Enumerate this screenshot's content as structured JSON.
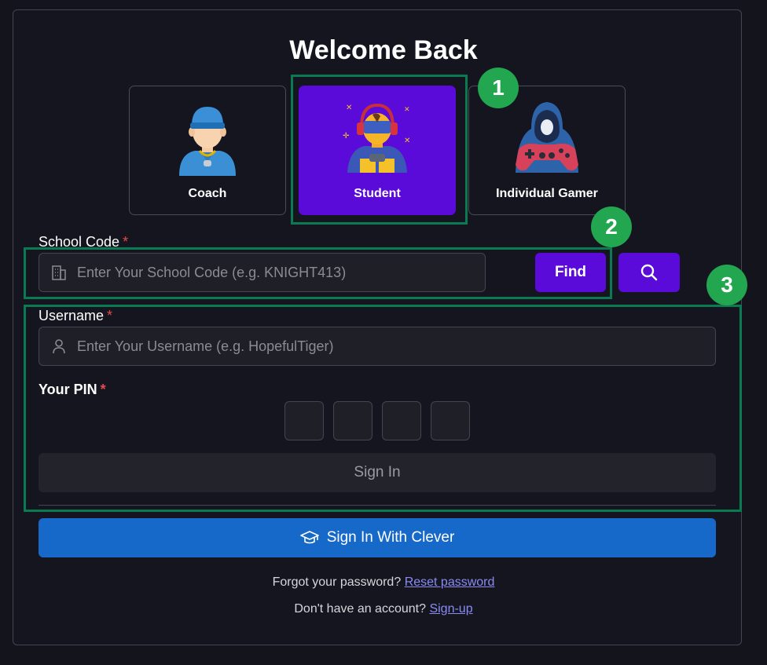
{
  "title": "Welcome Back",
  "roles": [
    {
      "label": "Coach",
      "icon": "coach-avatar-icon",
      "active": false
    },
    {
      "label": "Student",
      "icon": "student-gamer-avatar-icon",
      "active": true
    },
    {
      "label": "Individual Gamer",
      "icon": "hooded-gamer-avatar-icon",
      "active": false
    }
  ],
  "badges": [
    "1",
    "2",
    "3"
  ],
  "school_code": {
    "label": "School Code",
    "required_mark": "*",
    "placeholder": "Enter Your School Code (e.g. KNIGHT413)",
    "value": "",
    "find_label": "Find",
    "icon": "building-icon",
    "search_icon": "search-icon"
  },
  "username": {
    "label": "Username",
    "required_mark": "*",
    "placeholder": "Enter Your Username (e.g. HopefulTiger)",
    "value": "",
    "icon": "user-icon"
  },
  "pin": {
    "label": "Your PIN",
    "required_mark": "*",
    "digits": [
      "",
      "",
      "",
      ""
    ]
  },
  "sign_in_label": "Sign In",
  "clever": {
    "label": "Sign In With Clever",
    "icon": "graduation-cap-icon"
  },
  "forgot": {
    "text": "Forgot your password?",
    "link": "Reset password"
  },
  "signup": {
    "text": "Don't have an account?",
    "link": "Sign-up"
  },
  "colors": {
    "accent": "#5a0ad9",
    "clever_blue": "#1769c9",
    "highlight_green": "#0a7a52",
    "badge_green": "#22a650",
    "required_red": "#e34a4a"
  }
}
